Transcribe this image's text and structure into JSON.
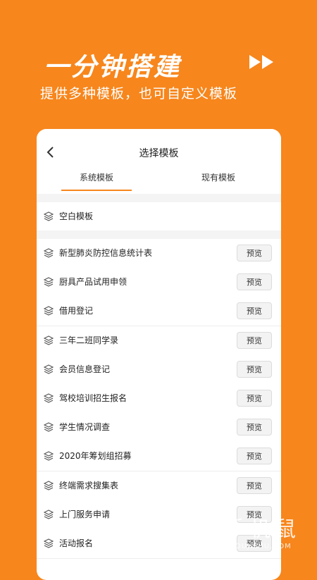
{
  "promo": {
    "headline": "一分钟搭建",
    "subline": "提供多种模板，也可自定义模板"
  },
  "header": {
    "title": "选择模板"
  },
  "tabs": [
    {
      "label": "系统模板",
      "active": true
    },
    {
      "label": "现有模板",
      "active": false
    }
  ],
  "blank_template": {
    "label": "空白模板"
  },
  "preview_label": "预览",
  "templates": [
    {
      "label": "新型肺炎防控信息统计表"
    },
    {
      "label": "厨具产品试用申领"
    },
    {
      "label": "借用登记"
    },
    {
      "label": "三年二班同学录"
    },
    {
      "label": "会员信息登记"
    },
    {
      "label": "驾校培训招生报名"
    },
    {
      "label": "学生情况调查"
    },
    {
      "label": "2020年筹划组招募"
    },
    {
      "label": "终端需求搜集表"
    },
    {
      "label": "上门服务申请"
    },
    {
      "label": "活动报名"
    }
  ],
  "watermark": {
    "text": "手机鼠",
    "en": "SHOUJISHU.COM"
  },
  "colors": {
    "accent": "#f7861c",
    "background": "#f7861c",
    "card": "#ffffff"
  }
}
